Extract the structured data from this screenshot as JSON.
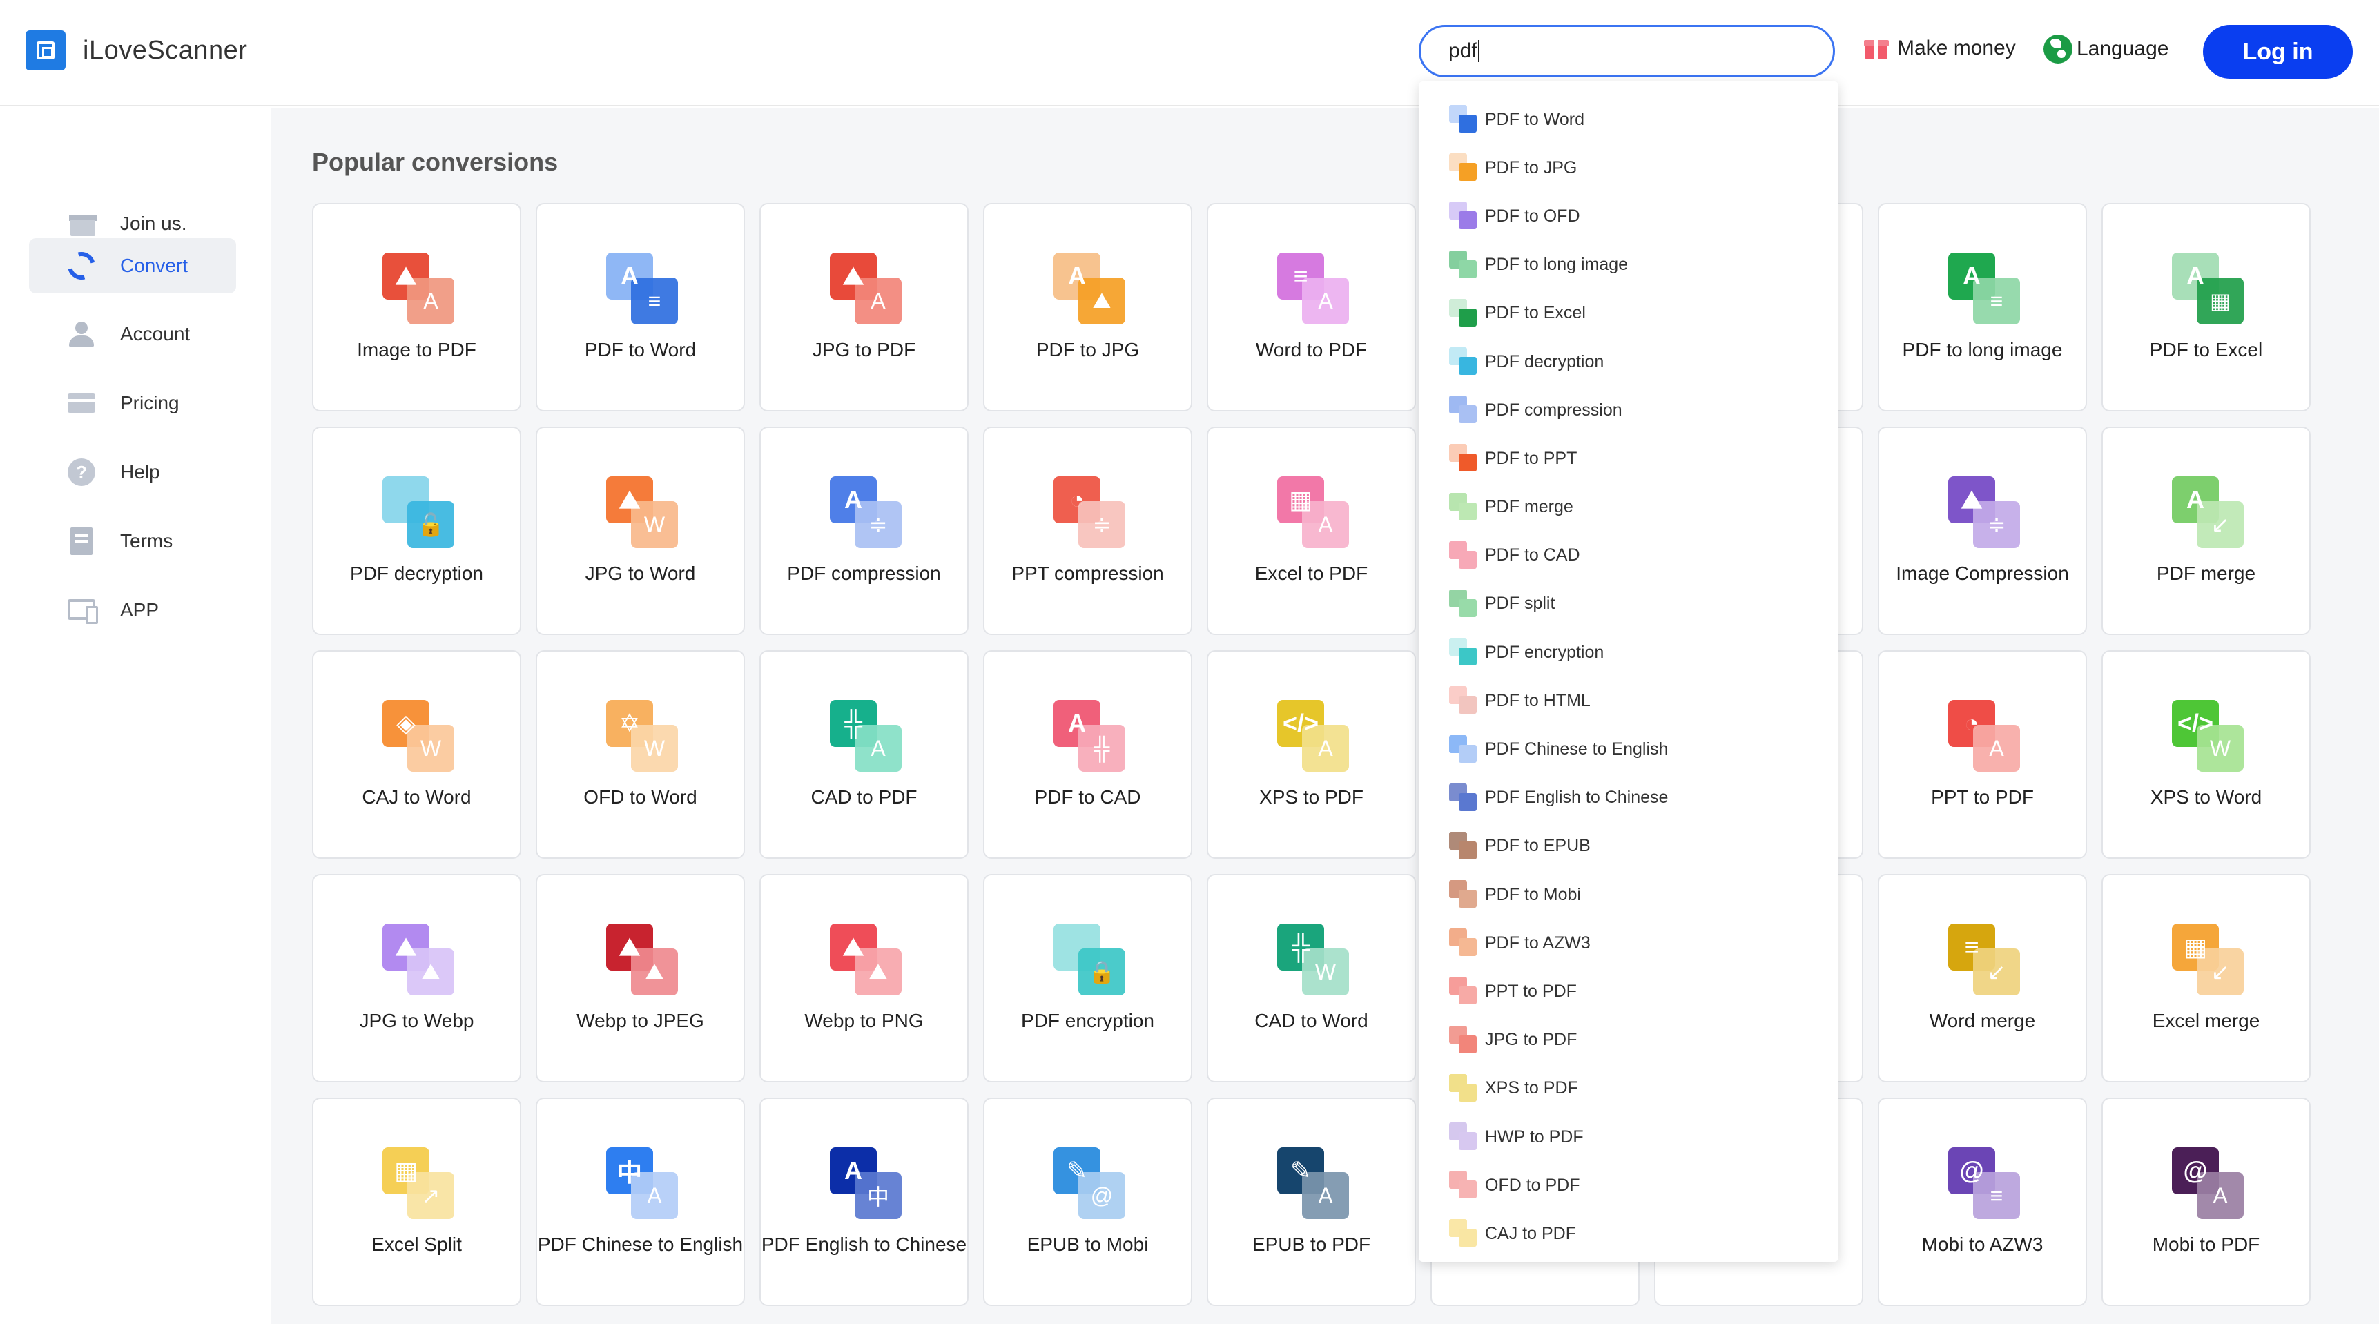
{
  "header": {
    "brand": "iLoveScanner",
    "search_value": "pdf",
    "make_money": "Make money",
    "language": "Language",
    "login": "Log in"
  },
  "sidebar": {
    "items": [
      {
        "label": "Join us.",
        "icon": "gift-icon"
      },
      {
        "label": "Convert",
        "icon": "convert-icon",
        "active": true
      },
      {
        "label": "Account",
        "icon": "user-icon"
      },
      {
        "label": "Pricing",
        "icon": "card-icon"
      },
      {
        "label": "Help",
        "icon": "help-icon"
      },
      {
        "label": "Terms",
        "icon": "document-icon"
      },
      {
        "label": "APP",
        "icon": "devices-icon"
      }
    ]
  },
  "main": {
    "section_title": "Popular conversions",
    "cards": [
      {
        "label": "Image to PDF",
        "c1": "#e8503b",
        "c2": "#f0977f",
        "g1": "⛰",
        "g2": "A"
      },
      {
        "label": "PDF to Word",
        "c1": "#8fb7f5",
        "c2": "#2f6fe0",
        "g1": "A",
        "g2": "≡"
      },
      {
        "label": "JPG to PDF",
        "c1": "#e84a3a",
        "c2": "#f2857a",
        "g1": "⛰",
        "g2": "A"
      },
      {
        "label": "PDF to JPG",
        "c1": "#f7c38f",
        "c2": "#f5a025",
        "g1": "A",
        "g2": "⛰"
      },
      {
        "label": "Word to PDF",
        "c1": "#d67ae0",
        "c2": "#ecb0f0",
        "g1": "≡",
        "g2": "A"
      },
      {
        "label": "",
        "c1": "",
        "c2": "",
        "g1": "",
        "g2": ""
      },
      {
        "label": "",
        "c1": "",
        "c2": "",
        "g1": "",
        "g2": ""
      },
      {
        "label": "PDF to long image",
        "c1": "#1fa84f",
        "c2": "#8ed7a6",
        "g1": "A",
        "g2": "≡"
      },
      {
        "label": "PDF to Excel",
        "c1": "#a8dfb8",
        "c2": "#1f9e4a",
        "g1": "A",
        "g2": "▦"
      },
      {
        "label": "PDF decryption",
        "c1": "#8fd8ec",
        "c2": "#38b6e0",
        "g1": "",
        "g2": "🔓"
      },
      {
        "label": "JPG to Word",
        "c1": "#f57b3a",
        "c2": "#f9b98b",
        "g1": "⛰",
        "g2": "W"
      },
      {
        "label": "PDF compression",
        "c1": "#4f7fe8",
        "c2": "#a9c0f3",
        "g1": "A",
        "g2": "≑"
      },
      {
        "label": "PPT compression",
        "c1": "#ef5f4f",
        "c2": "#f7c1bb",
        "g1": "◔",
        "g2": "≑"
      },
      {
        "label": "Excel to PDF",
        "c1": "#f278a8",
        "c2": "#f7b2cc",
        "g1": "▦",
        "g2": "A"
      },
      {
        "label": "",
        "c1": "",
        "c2": "",
        "g1": "",
        "g2": ""
      },
      {
        "label": "",
        "c1": "",
        "c2": "",
        "g1": "",
        "g2": ""
      },
      {
        "label": "Image Compression",
        "c1": "#7e55c9",
        "c2": "#c2aae8",
        "g1": "⛰",
        "g2": "≑"
      },
      {
        "label": "PDF merge",
        "c1": "#7dcf6d",
        "c2": "#bde8b3",
        "g1": "A",
        "g2": "↙"
      },
      {
        "label": "CAJ to Word",
        "c1": "#f7923a",
        "c2": "#fbc89a",
        "g1": "◈",
        "g2": "W"
      },
      {
        "label": "OFD to Word",
        "c1": "#f8b160",
        "c2": "#fbd6a8",
        "g1": "✡",
        "g2": "W"
      },
      {
        "label": "CAD to PDF",
        "c1": "#16b08c",
        "c2": "#86e0c6",
        "g1": "╬",
        "g2": "A"
      },
      {
        "label": "PDF to CAD",
        "c1": "#f0607a",
        "c2": "#f7a9b7",
        "g1": "A",
        "g2": "╬"
      },
      {
        "label": "XPS to PDF",
        "c1": "#e6c62a",
        "c2": "#f2e08a",
        "g1": "</>",
        "g2": "A"
      },
      {
        "label": "",
        "c1": "",
        "c2": "",
        "g1": "",
        "g2": ""
      },
      {
        "label": "",
        "c1": "",
        "c2": "",
        "g1": "",
        "g2": ""
      },
      {
        "label": "PPT to PDF",
        "c1": "#ef4d47",
        "c2": "#f7aaa6",
        "g1": "◔",
        "g2": "A"
      },
      {
        "label": "XPS to Word",
        "c1": "#4ec636",
        "c2": "#a6e393",
        "g1": "</>",
        "g2": "W"
      },
      {
        "label": "JPG to Webp",
        "c1": "#b28af0",
        "c2": "#d8c3f7",
        "g1": "⛰",
        "g2": "⛰"
      },
      {
        "label": "Webp to JPEG",
        "c1": "#c8232f",
        "c2": "#ef8a8f",
        "g1": "⛰",
        "g2": "⛰"
      },
      {
        "label": "Webp to PNG",
        "c1": "#ef4d58",
        "c2": "#f7a6ab",
        "g1": "⛰",
        "g2": "⛰"
      },
      {
        "label": "PDF encryption",
        "c1": "#9ee3e3",
        "c2": "#3cc7c7",
        "g1": "",
        "g2": "🔒"
      },
      {
        "label": "CAD to Word",
        "c1": "#1aa57c",
        "c2": "#a4e0c9",
        "g1": "╬",
        "g2": "W"
      },
      {
        "label": "",
        "c1": "",
        "c2": "",
        "g1": "",
        "g2": ""
      },
      {
        "label": "",
        "c1": "",
        "c2": "",
        "g1": "",
        "g2": ""
      },
      {
        "label": "Word merge",
        "c1": "#d6a60e",
        "c2": "#efd27e",
        "g1": "≡",
        "g2": "↙"
      },
      {
        "label": "Excel merge",
        "c1": "#f5a63a",
        "c2": "#f9d09a",
        "g1": "▦",
        "g2": "↙"
      },
      {
        "label": "Excel Split",
        "c1": "#f5cf55",
        "c2": "#f9e3a0",
        "g1": "▦",
        "g2": "↗"
      },
      {
        "label": "PDF Chinese to English",
        "c1": "#2e7ef0",
        "c2": "#b3cdf7",
        "g1": "中",
        "g2": "A"
      },
      {
        "label": "PDF English to Chinese",
        "c1": "#0c2ea8",
        "c2": "#5a78d0",
        "g1": "A",
        "g2": "中"
      },
      {
        "label": "EPUB to Mobi",
        "c1": "#3592e0",
        "c2": "#a8cdf1",
        "g1": "✎",
        "g2": "@"
      },
      {
        "label": "EPUB to PDF",
        "c1": "#16456d",
        "c2": "#7b95ad",
        "g1": "✎",
        "g2": "A"
      },
      {
        "label": "",
        "c1": "",
        "c2": "",
        "g1": "",
        "g2": ""
      },
      {
        "label": "",
        "c1": "",
        "c2": "",
        "g1": "",
        "g2": ""
      },
      {
        "label": "Mobi to AZW3",
        "c1": "#6b45b5",
        "c2": "#b8a2dc",
        "g1": "@",
        "g2": "≡"
      },
      {
        "label": "Mobi to PDF",
        "c1": "#4b1f57",
        "c2": "#9a7fa3",
        "g1": "@",
        "g2": "A"
      }
    ]
  },
  "dropdown": {
    "items": [
      {
        "label": "PDF to Word",
        "c1": "#8fb7f5",
        "c2": "#2f6fe0"
      },
      {
        "label": "PDF to JPG",
        "c1": "#f7c38f",
        "c2": "#f5a025"
      },
      {
        "label": "PDF to OFD",
        "c1": "#b79ef0",
        "c2": "#9b7be8"
      },
      {
        "label": "PDF to long image",
        "c1": "#1fa84f",
        "c2": "#8ed7a6"
      },
      {
        "label": "PDF to Excel",
        "c1": "#a8dfb8",
        "c2": "#1f9e4a"
      },
      {
        "label": "PDF decryption",
        "c1": "#8fd8ec",
        "c2": "#38b6e0"
      },
      {
        "label": "PDF compression",
        "c1": "#4f7fe8",
        "c2": "#a9c0f3"
      },
      {
        "label": "PDF to PPT",
        "c1": "#f7a27a",
        "c2": "#ef5a2a"
      },
      {
        "label": "PDF merge",
        "c1": "#7dcf6d",
        "c2": "#bde8b3"
      },
      {
        "label": "PDF to CAD",
        "c1": "#f0607a",
        "c2": "#f7a9b7"
      },
      {
        "label": "PDF split",
        "c1": "#3cb15a",
        "c2": "#98dba9"
      },
      {
        "label": "PDF encryption",
        "c1": "#9ee3e3",
        "c2": "#3cc7c7"
      },
      {
        "label": "PDF to HTML",
        "c1": "#f7a49a",
        "c2": "#f2c5bf"
      },
      {
        "label": "PDF Chinese to English",
        "c1": "#2e7ef0",
        "c2": "#b3cdf7"
      },
      {
        "label": "PDF English to Chinese",
        "c1": "#0c2ea8",
        "c2": "#5a78d0"
      },
      {
        "label": "PDF to EPUB",
        "c1": "#6e2a0a",
        "c2": "#b8866d"
      },
      {
        "label": "PDF to Mobi",
        "c1": "#b2451a",
        "c2": "#e0a98e"
      },
      {
        "label": "PDF to AZW3",
        "c1": "#e86a2a",
        "c2": "#f5b893"
      },
      {
        "label": "PPT to PDF",
        "c1": "#ef4d47",
        "c2": "#f7aaa6"
      },
      {
        "label": "JPG to PDF",
        "c1": "#e84a3a",
        "c2": "#f2857a"
      },
      {
        "label": "XPS to PDF",
        "c1": "#e6c62a",
        "c2": "#f2e08a"
      },
      {
        "label": "HWP to PDF",
        "c1": "#b39ae0",
        "c2": "#d7c8f0"
      },
      {
        "label": "OFD to PDF",
        "c1": "#ef6f6f",
        "c2": "#f7b3b3"
      },
      {
        "label": "CAJ to PDF",
        "c1": "#f5d45f",
        "c2": "#f9e6a3"
      }
    ]
  }
}
